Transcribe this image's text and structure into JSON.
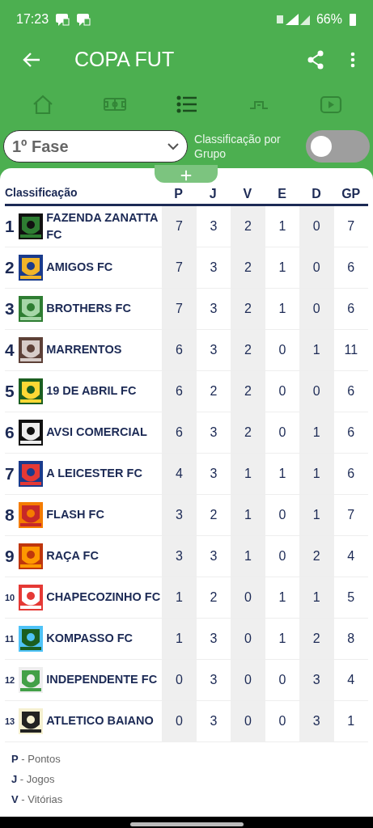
{
  "status_bar": {
    "time": "17:23",
    "battery": "66%"
  },
  "app_bar": {
    "title": "COPA FUT"
  },
  "tabs": [
    {
      "kind": "home",
      "selected": false
    },
    {
      "kind": "field",
      "selected": false
    },
    {
      "kind": "list",
      "selected": true
    },
    {
      "kind": "bracket",
      "selected": false
    },
    {
      "kind": "video",
      "selected": false
    }
  ],
  "phase_select": {
    "value": "1º Fase"
  },
  "group_toggle": {
    "label": "Classificação por Grupo",
    "on": false
  },
  "table": {
    "columns": [
      "Classificação",
      "P",
      "J",
      "V",
      "E",
      "D",
      "GP"
    ],
    "rows": [
      {
        "rank": "1",
        "team": "FAZENDA ZANATTA FC",
        "stats": [
          "7",
          "3",
          "2",
          "1",
          "0",
          "7"
        ]
      },
      {
        "rank": "2",
        "team": "AMIGOS FC",
        "stats": [
          "7",
          "3",
          "2",
          "1",
          "0",
          "6"
        ]
      },
      {
        "rank": "3",
        "team": "BROTHERS FC",
        "stats": [
          "7",
          "3",
          "2",
          "1",
          "0",
          "6"
        ]
      },
      {
        "rank": "4",
        "team": "MARRENTOS",
        "stats": [
          "6",
          "3",
          "2",
          "0",
          "1",
          "11"
        ]
      },
      {
        "rank": "5",
        "team": "19 DE ABRIL FC",
        "stats": [
          "6",
          "2",
          "2",
          "0",
          "0",
          "6"
        ]
      },
      {
        "rank": "6",
        "team": "AVSI COMERCIAL",
        "stats": [
          "6",
          "3",
          "2",
          "0",
          "1",
          "6"
        ]
      },
      {
        "rank": "7",
        "team": "A LEICESTER FC",
        "stats": [
          "4",
          "3",
          "1",
          "1",
          "1",
          "6"
        ]
      },
      {
        "rank": "8",
        "team": "FLASH FC",
        "stats": [
          "3",
          "2",
          "1",
          "0",
          "1",
          "7"
        ]
      },
      {
        "rank": "9",
        "team": "RAÇA FC",
        "stats": [
          "3",
          "3",
          "1",
          "0",
          "2",
          "4"
        ]
      },
      {
        "rank": "10",
        "team": "CHAPECOZINHO FC",
        "stats": [
          "1",
          "2",
          "0",
          "1",
          "1",
          "5"
        ]
      },
      {
        "rank": "11",
        "team": "KOMPASSO FC",
        "stats": [
          "1",
          "3",
          "0",
          "1",
          "2",
          "8"
        ]
      },
      {
        "rank": "12",
        "team": "INDEPENDENTE FC",
        "stats": [
          "0",
          "3",
          "0",
          "0",
          "3",
          "4"
        ]
      },
      {
        "rank": "13",
        "team": "ATLETICO BAIANO",
        "stats": [
          "0",
          "3",
          "0",
          "0",
          "3",
          "1"
        ]
      }
    ]
  },
  "legend": [
    "**P** - Pontos",
    "**J** - Jogos",
    "**V** - Vitórias"
  ]
}
